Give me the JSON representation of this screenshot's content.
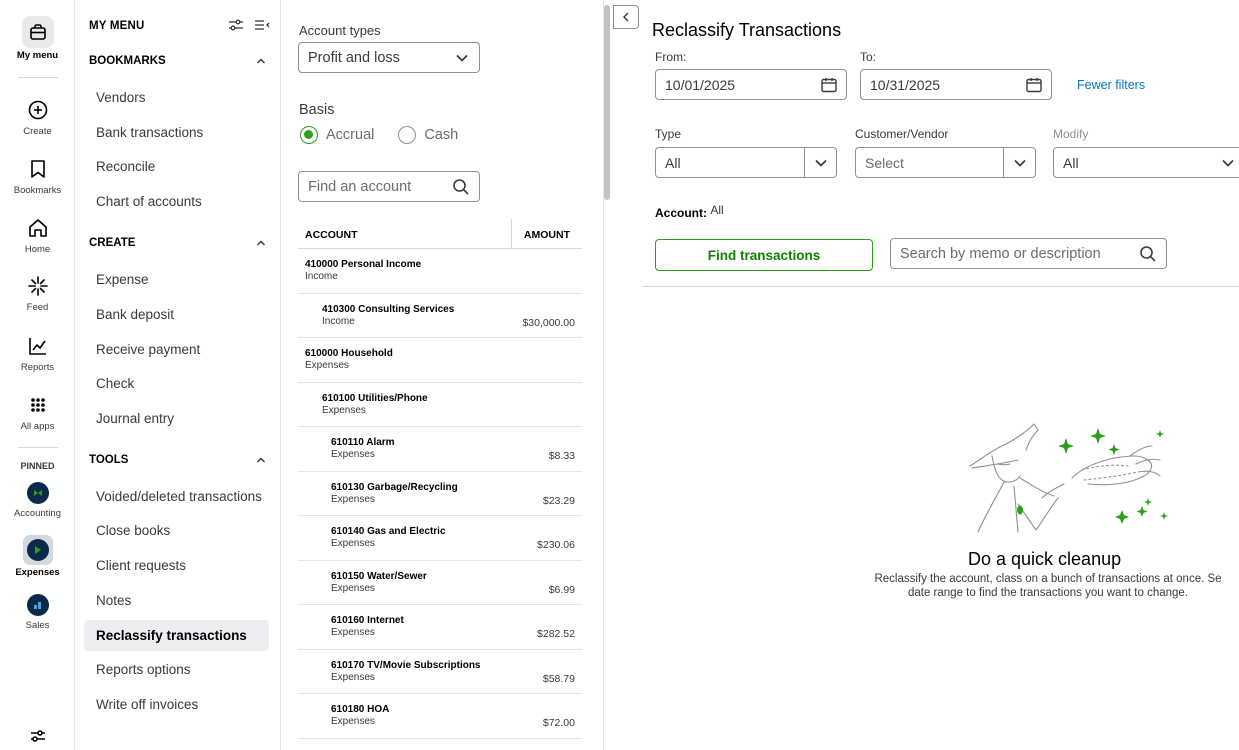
{
  "rail": {
    "items": [
      {
        "label": "My menu",
        "icon": "briefcase-icon"
      },
      {
        "label": "Create",
        "icon": "plus-circle-icon"
      },
      {
        "label": "Bookmarks",
        "icon": "bookmark-icon"
      },
      {
        "label": "Home",
        "icon": "home-icon"
      },
      {
        "label": "Feed",
        "icon": "sparkle-icon"
      },
      {
        "label": "Reports",
        "icon": "line-chart-icon"
      },
      {
        "label": "All apps",
        "icon": "grid-dots-icon"
      }
    ],
    "pinned_label": "PINNED",
    "pinned": [
      {
        "label": "Accounting",
        "icon": "accounting-app-icon"
      },
      {
        "label": "Expenses",
        "icon": "expenses-app-icon"
      },
      {
        "label": "Sales",
        "icon": "sales-app-icon"
      }
    ]
  },
  "menu": {
    "title": "MY MENU",
    "sections": [
      {
        "title": "BOOKMARKS",
        "items": [
          "Vendors",
          "Bank transactions",
          "Reconcile",
          "Chart of accounts"
        ]
      },
      {
        "title": "CREATE",
        "items": [
          "Expense",
          "Bank deposit",
          "Receive payment",
          "Check",
          "Journal entry"
        ]
      },
      {
        "title": "TOOLS",
        "items": [
          "Voided/deleted transactions",
          "Close books",
          "Client requests",
          "Notes",
          "Reclassify transactions",
          "Reports options",
          "Write off invoices"
        ]
      }
    ],
    "active_item": "Reclassify transactions"
  },
  "accounts": {
    "account_types_label": "Account types",
    "account_types_value": "Profit and loss",
    "basis_label": "Basis",
    "basis_options": [
      "Accrual",
      "Cash"
    ],
    "basis_selected": "Accrual",
    "search_placeholder": "Find an account",
    "columns": [
      "ACCOUNT",
      "AMOUNT"
    ],
    "rows": [
      {
        "name": "410000 Personal Income",
        "type": "Income",
        "amount": "",
        "level": 0
      },
      {
        "name": "410300 Consulting Services",
        "type": "Income",
        "amount": "$30,000.00",
        "level": 1
      },
      {
        "name": "610000 Household",
        "type": "Expenses",
        "amount": "",
        "level": 0
      },
      {
        "name": "610100 Utilities/Phone",
        "type": "Expenses",
        "amount": "",
        "level": 1
      },
      {
        "name": "610110 Alarm",
        "type": "Expenses",
        "amount": "$8.33",
        "level": 2
      },
      {
        "name": "610130 Garbage/Recycling",
        "type": "Expenses",
        "amount": "$23.29",
        "level": 2
      },
      {
        "name": "610140 Gas and Electric",
        "type": "Expenses",
        "amount": "$230.06",
        "level": 2
      },
      {
        "name": "610150 Water/Sewer",
        "type": "Expenses",
        "amount": "$6.99",
        "level": 2
      },
      {
        "name": "610160 Internet",
        "type": "Expenses",
        "amount": "$282.52",
        "level": 2
      },
      {
        "name": "610170 TV/Movie Subscriptions",
        "type": "Expenses",
        "amount": "$58.79",
        "level": 2
      },
      {
        "name": "610180 HOA",
        "type": "Expenses",
        "amount": "$72.00",
        "level": 2
      }
    ]
  },
  "main": {
    "title": "Reclassify Transactions",
    "from_label": "From:",
    "from_value": "10/01/2025",
    "to_label": "To:",
    "to_value": "10/31/2025",
    "fewer_filters": "Fewer filters",
    "type_label": "Type",
    "type_value": "All",
    "customer_vendor_label": "Customer/Vendor",
    "customer_vendor_placeholder": "Select",
    "modify_label": "Modify",
    "modify_value": "All",
    "account_label": "Account:",
    "account_value": "All",
    "find_button": "Find transactions",
    "search_placeholder": "Search by memo or description",
    "empty_title": "Do a quick cleanup",
    "empty_line1": "Reclassify the account, class on a bunch of transactions at once. Se",
    "empty_line2": "date range to find the transactions you want to change."
  },
  "colors": {
    "accent_green": "#2ca01c",
    "link_blue": "#0077c5",
    "dark_navy": "#0b2a4a"
  }
}
